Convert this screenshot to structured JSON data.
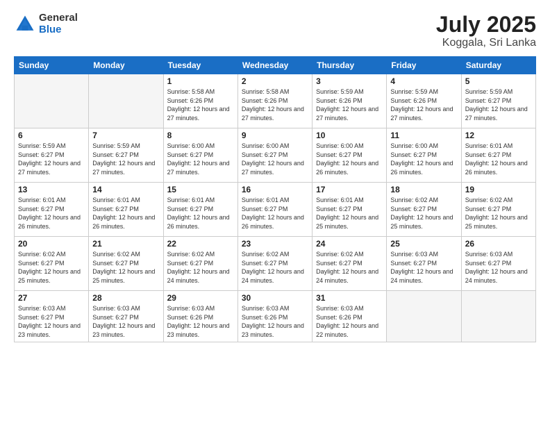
{
  "logo": {
    "general": "General",
    "blue": "Blue"
  },
  "title": {
    "month": "July 2025",
    "location": "Koggala, Sri Lanka"
  },
  "days_of_week": [
    "Sunday",
    "Monday",
    "Tuesday",
    "Wednesday",
    "Thursday",
    "Friday",
    "Saturday"
  ],
  "weeks": [
    [
      {
        "day": "",
        "info": ""
      },
      {
        "day": "",
        "info": ""
      },
      {
        "day": "1",
        "info": "Sunrise: 5:58 AM\nSunset: 6:26 PM\nDaylight: 12 hours and 27 minutes."
      },
      {
        "day": "2",
        "info": "Sunrise: 5:58 AM\nSunset: 6:26 PM\nDaylight: 12 hours and 27 minutes."
      },
      {
        "day": "3",
        "info": "Sunrise: 5:59 AM\nSunset: 6:26 PM\nDaylight: 12 hours and 27 minutes."
      },
      {
        "day": "4",
        "info": "Sunrise: 5:59 AM\nSunset: 6:26 PM\nDaylight: 12 hours and 27 minutes."
      },
      {
        "day": "5",
        "info": "Sunrise: 5:59 AM\nSunset: 6:27 PM\nDaylight: 12 hours and 27 minutes."
      }
    ],
    [
      {
        "day": "6",
        "info": "Sunrise: 5:59 AM\nSunset: 6:27 PM\nDaylight: 12 hours and 27 minutes."
      },
      {
        "day": "7",
        "info": "Sunrise: 5:59 AM\nSunset: 6:27 PM\nDaylight: 12 hours and 27 minutes."
      },
      {
        "day": "8",
        "info": "Sunrise: 6:00 AM\nSunset: 6:27 PM\nDaylight: 12 hours and 27 minutes."
      },
      {
        "day": "9",
        "info": "Sunrise: 6:00 AM\nSunset: 6:27 PM\nDaylight: 12 hours and 27 minutes."
      },
      {
        "day": "10",
        "info": "Sunrise: 6:00 AM\nSunset: 6:27 PM\nDaylight: 12 hours and 26 minutes."
      },
      {
        "day": "11",
        "info": "Sunrise: 6:00 AM\nSunset: 6:27 PM\nDaylight: 12 hours and 26 minutes."
      },
      {
        "day": "12",
        "info": "Sunrise: 6:01 AM\nSunset: 6:27 PM\nDaylight: 12 hours and 26 minutes."
      }
    ],
    [
      {
        "day": "13",
        "info": "Sunrise: 6:01 AM\nSunset: 6:27 PM\nDaylight: 12 hours and 26 minutes."
      },
      {
        "day": "14",
        "info": "Sunrise: 6:01 AM\nSunset: 6:27 PM\nDaylight: 12 hours and 26 minutes."
      },
      {
        "day": "15",
        "info": "Sunrise: 6:01 AM\nSunset: 6:27 PM\nDaylight: 12 hours and 26 minutes."
      },
      {
        "day": "16",
        "info": "Sunrise: 6:01 AM\nSunset: 6:27 PM\nDaylight: 12 hours and 26 minutes."
      },
      {
        "day": "17",
        "info": "Sunrise: 6:01 AM\nSunset: 6:27 PM\nDaylight: 12 hours and 25 minutes."
      },
      {
        "day": "18",
        "info": "Sunrise: 6:02 AM\nSunset: 6:27 PM\nDaylight: 12 hours and 25 minutes."
      },
      {
        "day": "19",
        "info": "Sunrise: 6:02 AM\nSunset: 6:27 PM\nDaylight: 12 hours and 25 minutes."
      }
    ],
    [
      {
        "day": "20",
        "info": "Sunrise: 6:02 AM\nSunset: 6:27 PM\nDaylight: 12 hours and 25 minutes."
      },
      {
        "day": "21",
        "info": "Sunrise: 6:02 AM\nSunset: 6:27 PM\nDaylight: 12 hours and 25 minutes."
      },
      {
        "day": "22",
        "info": "Sunrise: 6:02 AM\nSunset: 6:27 PM\nDaylight: 12 hours and 24 minutes."
      },
      {
        "day": "23",
        "info": "Sunrise: 6:02 AM\nSunset: 6:27 PM\nDaylight: 12 hours and 24 minutes."
      },
      {
        "day": "24",
        "info": "Sunrise: 6:02 AM\nSunset: 6:27 PM\nDaylight: 12 hours and 24 minutes."
      },
      {
        "day": "25",
        "info": "Sunrise: 6:03 AM\nSunset: 6:27 PM\nDaylight: 12 hours and 24 minutes."
      },
      {
        "day": "26",
        "info": "Sunrise: 6:03 AM\nSunset: 6:27 PM\nDaylight: 12 hours and 24 minutes."
      }
    ],
    [
      {
        "day": "27",
        "info": "Sunrise: 6:03 AM\nSunset: 6:27 PM\nDaylight: 12 hours and 23 minutes."
      },
      {
        "day": "28",
        "info": "Sunrise: 6:03 AM\nSunset: 6:27 PM\nDaylight: 12 hours and 23 minutes."
      },
      {
        "day": "29",
        "info": "Sunrise: 6:03 AM\nSunset: 6:26 PM\nDaylight: 12 hours and 23 minutes."
      },
      {
        "day": "30",
        "info": "Sunrise: 6:03 AM\nSunset: 6:26 PM\nDaylight: 12 hours and 23 minutes."
      },
      {
        "day": "31",
        "info": "Sunrise: 6:03 AM\nSunset: 6:26 PM\nDaylight: 12 hours and 22 minutes."
      },
      {
        "day": "",
        "info": ""
      },
      {
        "day": "",
        "info": ""
      }
    ]
  ]
}
